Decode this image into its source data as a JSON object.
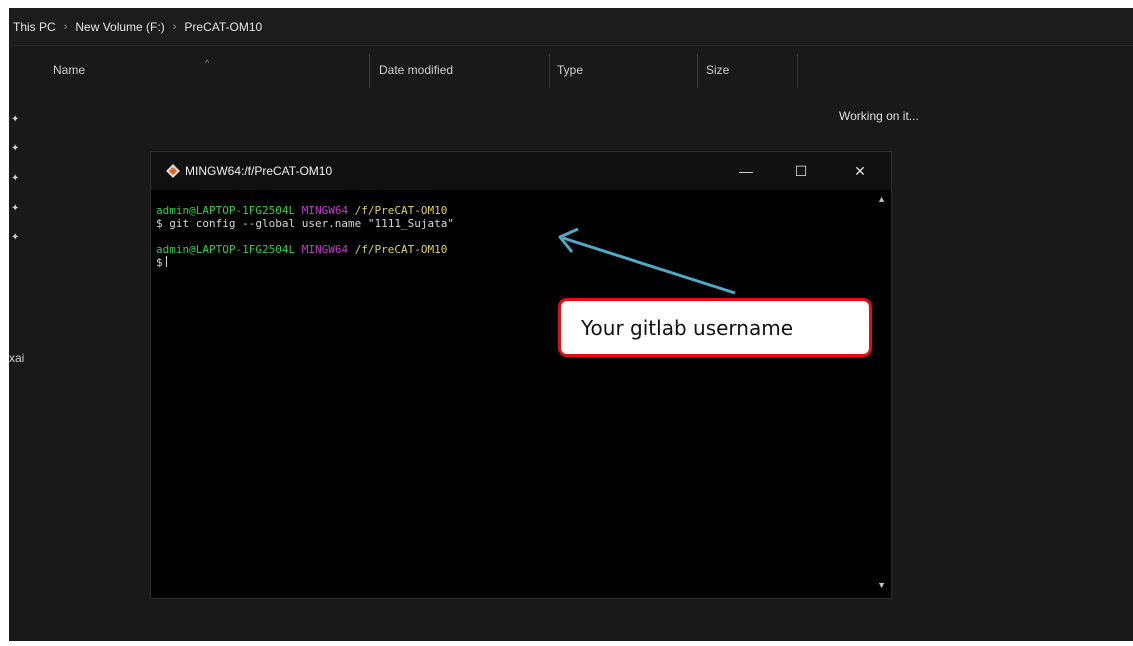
{
  "explorer": {
    "breadcrumb": [
      "This PC",
      "New Volume (F:)",
      "PreCAT-OM10"
    ],
    "columns": [
      "Name",
      "Date modified",
      "Type",
      "Size"
    ],
    "status_text": "Working on it...",
    "side_text": "xai"
  },
  "terminal": {
    "title": "MINGW64:/f/PreCAT-OM10",
    "controls": {
      "minimize": "—",
      "maximize": "☐",
      "close": "✕"
    },
    "prompt1": {
      "user": "admin@LAPTOP-1FG2504L",
      "env": "MINGW64",
      "path": "/f/PreCAT-OM10"
    },
    "command": "$ git config --global user.name \"1111_Sujata\"",
    "prompt2": {
      "user": "admin@LAPTOP-1FG2504L",
      "env": "MINGW64",
      "path": "/f/PreCAT-OM10"
    },
    "input_prompt": "$"
  },
  "annotation": {
    "callout_text": "Your gitlab username",
    "arrow_color": "#4eaac8",
    "callout_border_color": "#e01010"
  },
  "icons": {
    "pin": "pin-icon",
    "git_bash": "git-bash-icon",
    "sort": "sort-up-icon"
  }
}
